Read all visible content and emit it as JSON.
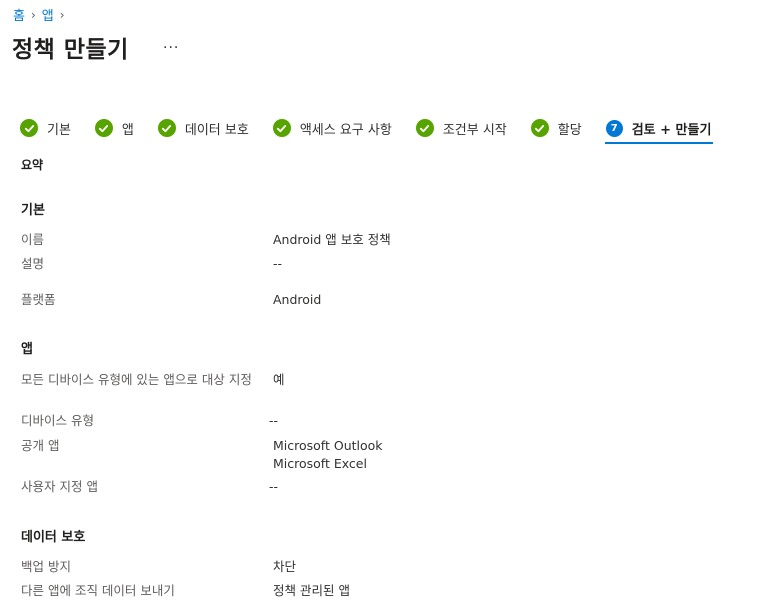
{
  "breadcrumb": {
    "home": "홈",
    "apps": "앱",
    "sep": "›"
  },
  "page": {
    "title": "정책 만들기",
    "more": "..."
  },
  "wizard": {
    "steps": [
      {
        "label": "기본",
        "state": "done"
      },
      {
        "label": "앱",
        "state": "done"
      },
      {
        "label": "데이터 보호",
        "state": "done"
      },
      {
        "label": "액세스 요구 사항",
        "state": "done"
      },
      {
        "label": "조건부 시작",
        "state": "done"
      },
      {
        "label": "할당",
        "state": "done"
      },
      {
        "label": "검토 + 만들기",
        "state": "active",
        "number": "7"
      }
    ]
  },
  "summary_title": "요약",
  "sections": {
    "basics": {
      "heading": "기본",
      "name_label": "이름",
      "name_value": "Android 앱 보호 정책",
      "desc_label": "설명",
      "desc_value": "--",
      "platform_label": "플랫폼",
      "platform_value": "Android"
    },
    "apps": {
      "heading": "앱",
      "target_label": "모든 디바이스 유형에 있는 앱으로 대상 지정",
      "target_value": "예",
      "device_label": "디바이스 유형",
      "device_value": "--",
      "public_label": "공개 앱",
      "public_value_1": "Microsoft Outlook",
      "public_value_2": "Microsoft Excel",
      "custom_label": "사용자 지정 앱",
      "custom_value": "--"
    },
    "data_protection": {
      "heading": "데이터 보호",
      "backup_label": "백업 방지",
      "backup_value": "차단",
      "send_label": "다른 앱에 조직 데이터 보내기",
      "send_value": "정책 관리된 앱"
    }
  },
  "colors": {
    "accent": "#0078d4",
    "success": "#57a300",
    "text": "#323130",
    "muted": "#605e5c"
  }
}
